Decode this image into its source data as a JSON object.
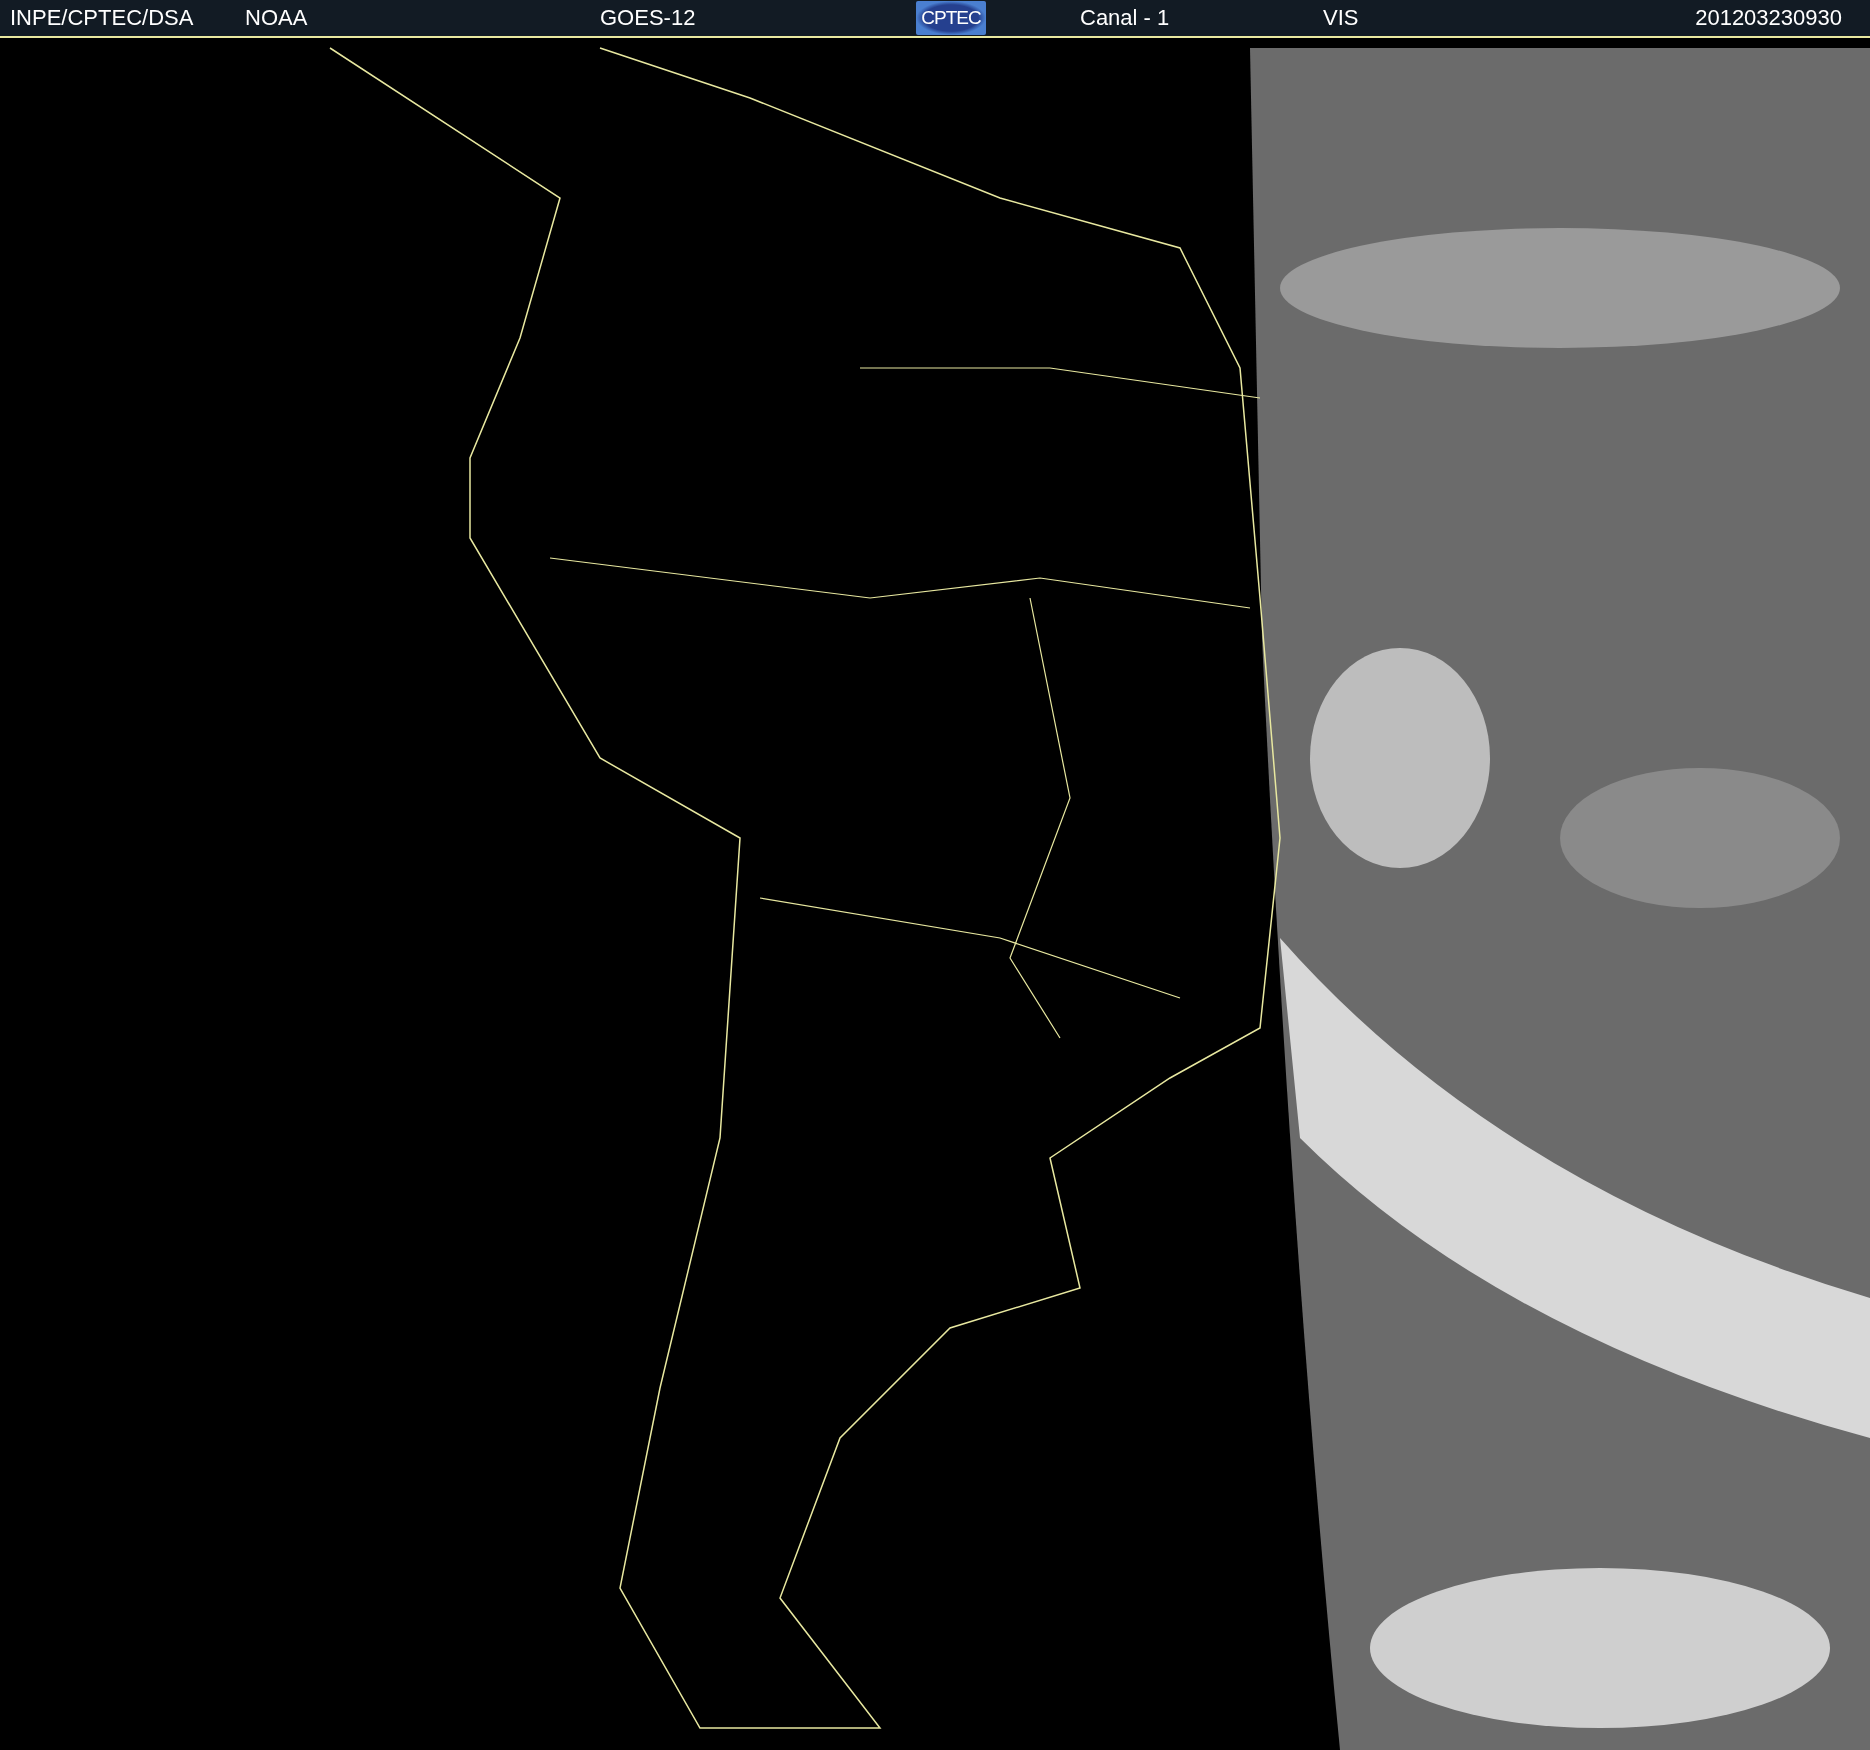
{
  "header": {
    "source": "INPE/CPTEC/DSA",
    "agency": "NOAA",
    "satellite": "GOES-12",
    "logo_text": "CPTEC",
    "channel": "Canal - 1",
    "band": "VIS",
    "timestamp": "201203230930"
  }
}
